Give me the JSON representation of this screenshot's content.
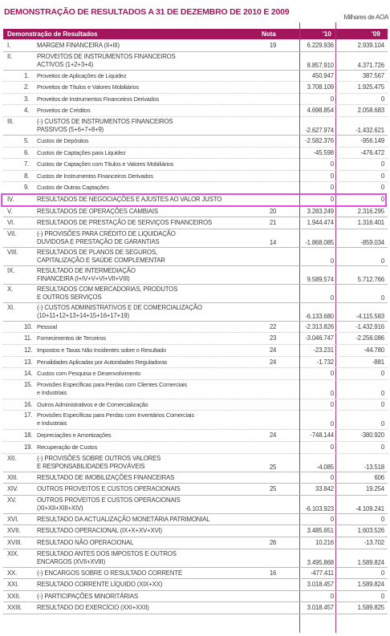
{
  "title": "DEMONSTRAÇÃO DE RESULTADOS A 31 DE DEZEMBRO DE 2010 E 2009",
  "units": "Milhares de AOA",
  "header": {
    "label": "Demonstração de Resultados",
    "nota": "Nota",
    "y10": "'10",
    "y09": "'09"
  },
  "colors": {
    "brand": "#a4165b",
    "highlight": "#e94be7"
  },
  "rows": [
    {
      "n": "I.",
      "label": "MARGEM FINANCEIRA (II+III)",
      "nota": "19",
      "v10": "6.229.936",
      "v09": "2.939.104"
    },
    {
      "n": "II.",
      "label": "PROVEITOS DE INSTRUMENTOS FINANCEIROS",
      "label2": "ACTIVOS (1+2+3+4)",
      "nota": "",
      "v10": "8.857.910",
      "v09": "4.371.726"
    },
    {
      "n": "1.",
      "label": "Proveitos de Aplicações de Liquidez",
      "nota": "",
      "v10": "450.947",
      "v09": "387.567",
      "sub": true
    },
    {
      "n": "2.",
      "label": "Proveitos de Títulos e Valores Mobiliários",
      "nota": "",
      "v10": "3.708.109",
      "v09": "1.925.475",
      "sub": true
    },
    {
      "n": "3.",
      "label": "Proveitos de Instrumentos Financeiros Derivados",
      "nota": "",
      "v10": "0",
      "v09": "0",
      "sub": true
    },
    {
      "n": "4.",
      "label": "Proveitos de Créditos",
      "nota": "",
      "v10": "4.698.854",
      "v09": "2.058.683",
      "sub": true
    },
    {
      "n": "III.",
      "label": "(-) CUSTOS DE INSTRUMENTOS FINANCEIROS",
      "label2": "PASSIVOS (5+6+7+8+9)",
      "nota": "",
      "v10": "-2.627.974",
      "v09": "-1.432.621"
    },
    {
      "n": "5.",
      "label": "Custos de Depósitos",
      "nota": "",
      "v10": "-2.582.376",
      "v09": "-956.149",
      "sub": true
    },
    {
      "n": "6.",
      "label": "Custos de Captações para Liquidez",
      "nota": "",
      "v10": "-45.598",
      "v09": "-476.472",
      "sub": true
    },
    {
      "n": "7.",
      "label": "Custos de Captações com Títulos e Valores Mobiliários",
      "nota": "",
      "v10": "0",
      "v09": "0",
      "sub": true
    },
    {
      "n": "8.",
      "label": "Custos de Instrumentos Financeiros Derivados",
      "nota": "",
      "v10": "0",
      "v09": "0",
      "sub": true
    },
    {
      "n": "9.",
      "label": "Custos de Outras Captações",
      "nota": "",
      "v10": "0",
      "v09": "0",
      "sub": true
    },
    {
      "n": "IV.",
      "label": "RESULTADOS DE NEGOCIAÇÕES E AJUSTES AO VALOR JUSTO",
      "nota": "",
      "v10": "0",
      "v09": "0"
    },
    {
      "n": "V.",
      "label": "RESULTADOS DE OPERAÇÕES CAMBIAIS",
      "nota": "20",
      "v10": "3.283.249",
      "v09": "2.316.295"
    },
    {
      "n": "VI.",
      "label": "RESULTADOS DE PRESTAÇÃO DE SERVIÇOS FINANCEIROS",
      "nota": "21",
      "v10": "1.944.474",
      "v09": "1.316.401"
    },
    {
      "n": "VII.",
      "label": "(-) PROVISÕES PARA CRÉDITO DE LIQUIDAÇÃO",
      "label2": "DUVIDOSA E PRESTAÇÃO DE GARANTIAS",
      "nota": "14",
      "v10": "-1.868.085",
      "v09": "-859.034"
    },
    {
      "n": "VIII.",
      "label": "RESULTADOS DE PLANOS DE SEGUROS,",
      "label2": "CAPITALIZAÇÃO E SAÚDE COMPLEMENTAR",
      "nota": "",
      "v10": "0",
      "v09": "0"
    },
    {
      "n": "IX.",
      "label": "RESULTADO DE INTERMEDIAÇÃO",
      "label2": "FINANCEIRA (I+IV+V+VI+VII+VIII)",
      "nota": "",
      "v10": "9.589.574",
      "v09": "5.712.766"
    },
    {
      "n": "X.",
      "label": "RESULTADOS COM MERCADORIAS, PRODUTOS",
      "label2": "E OUTROS SERVIÇOS",
      "nota": "",
      "v10": "0",
      "v09": "0"
    },
    {
      "n": "XI.",
      "label": "(-) CUSTOS ADMINISTRATIVOS E DE COMERCIALIZAÇÃO",
      "label2": "(10+11+12+13+14+15+16+17+19)",
      "nota": "",
      "v10": "-6.133.680",
      "v09": "-4.115.583"
    },
    {
      "n": "10.",
      "label": "Pessoal",
      "nota": "22",
      "v10": "-2.313.826",
      "v09": "-1.432.916",
      "sub": true
    },
    {
      "n": "11.",
      "label": "Fornecimentos de Terceiros",
      "nota": "23",
      "v10": "-3.046.747",
      "v09": "-2.256.086",
      "sub": true
    },
    {
      "n": "12.",
      "label": "Impostos e Taxas Não Incidentes sobre o Resultado",
      "nota": "24",
      "v10": "-23.231",
      "v09": "-44.780",
      "sub": true
    },
    {
      "n": "13.",
      "label": "Penalidades Aplicadas por Autoridades Reguladoras",
      "nota": "24",
      "v10": "-1.732",
      "v09": "-881",
      "sub": true
    },
    {
      "n": "14.",
      "label": "Custos com Pesquisa e Desenvolvimento",
      "nota": "",
      "v10": "0",
      "v09": "0",
      "sub": true
    },
    {
      "n": "15.",
      "label": "Provisões Específicas para Perdas com Clientes Comerciais",
      "label2": "e Industriais",
      "nota": "",
      "v10": "0",
      "v09": "0",
      "sub": true
    },
    {
      "n": "16.",
      "label": "Outros Administrativos e de Comercialização",
      "nota": "",
      "v10": "0",
      "v09": "0",
      "sub": true
    },
    {
      "n": "17.",
      "label": "Provisões Específicas para Perdas com Inventários Comerciais",
      "label2": "e Industriais",
      "nota": "",
      "v10": "0",
      "v09": "0",
      "sub": true
    },
    {
      "n": "18.",
      "label": "Depreciações e Amortizações",
      "nota": "24",
      "v10": "-748.144",
      "v09": "-380.920",
      "sub": true
    },
    {
      "n": "19.",
      "label": "Recuperação de Custos",
      "nota": "",
      "v10": "0",
      "v09": "0",
      "sub": true
    },
    {
      "n": "XII.",
      "label": "(-) PROVISÕES SOBRE OUTROS VALORES",
      "label2": "E RESPONSABILIDADES PROVÁVEIS",
      "nota": "25",
      "v10": "-4.085",
      "v09": "-13.518"
    },
    {
      "n": "XIII.",
      "label": "RESULTADO DE IMOBILIZAÇÕES FINANCEIRAS",
      "nota": "",
      "v10": "0",
      "v09": "606"
    },
    {
      "n": "XIV.",
      "label": "OUTROS PROVEITOS E CUSTOS OPERACIONAIS",
      "nota": "25",
      "v10": "33.842",
      "v09": "19.254"
    },
    {
      "n": "XV.",
      "label": "OUTROS PROVEITOS E CUSTOS OPERACIONAIS",
      "label2": "(XI+XII+XIII+XIV)",
      "nota": "",
      "v10": "-6.103.923",
      "v09": "-4.109.241"
    },
    {
      "n": "XVI.",
      "label": "RESULTADO DA ACTUALIZAÇÃO MONETÁRIA PATRIMONIAL",
      "nota": "",
      "v10": "0",
      "v09": "0"
    },
    {
      "n": "XVII.",
      "label": "RESULTADO OPERACIONAL (IX+X+XV+XVI)",
      "nota": "",
      "v10": "3.485.651",
      "v09": "1.603.526"
    },
    {
      "n": "XVIII.",
      "label": "RESULTADO NÃO OPERACIONAL",
      "nota": "26",
      "v10": "10.216",
      "v09": "-13.702"
    },
    {
      "n": "XIX.",
      "label": "RESULTADO ANTES DOS IMPOSTOS E OUTROS",
      "label2": "ENCARGOS (XVII+XVIII)",
      "nota": "",
      "v10": "3.495.868",
      "v09": "1.589.824"
    },
    {
      "n": "XX.",
      "label": "(-) ENCARGOS SOBRE O RESULTADO CORRENTE",
      "nota": "16",
      "v10": "-477.411",
      "v09": "0"
    },
    {
      "n": "XXI.",
      "label": "RESULTADO CORRENTE LÍQUIDO (XIX+XX)",
      "nota": "",
      "v10": "3.018.457",
      "v09": "1.589.824"
    },
    {
      "n": "XXII.",
      "label": "(-) PARTICIPAÇÕES MINORITÁRIAS",
      "nota": "",
      "v10": "0",
      "v09": "0"
    },
    {
      "n": "XXIII.",
      "label": "RESULTADO DO EXERCÍCIO (XXI+XXII)",
      "nota": "",
      "v10": "3.018.457",
      "v09": "1.589.825"
    }
  ]
}
